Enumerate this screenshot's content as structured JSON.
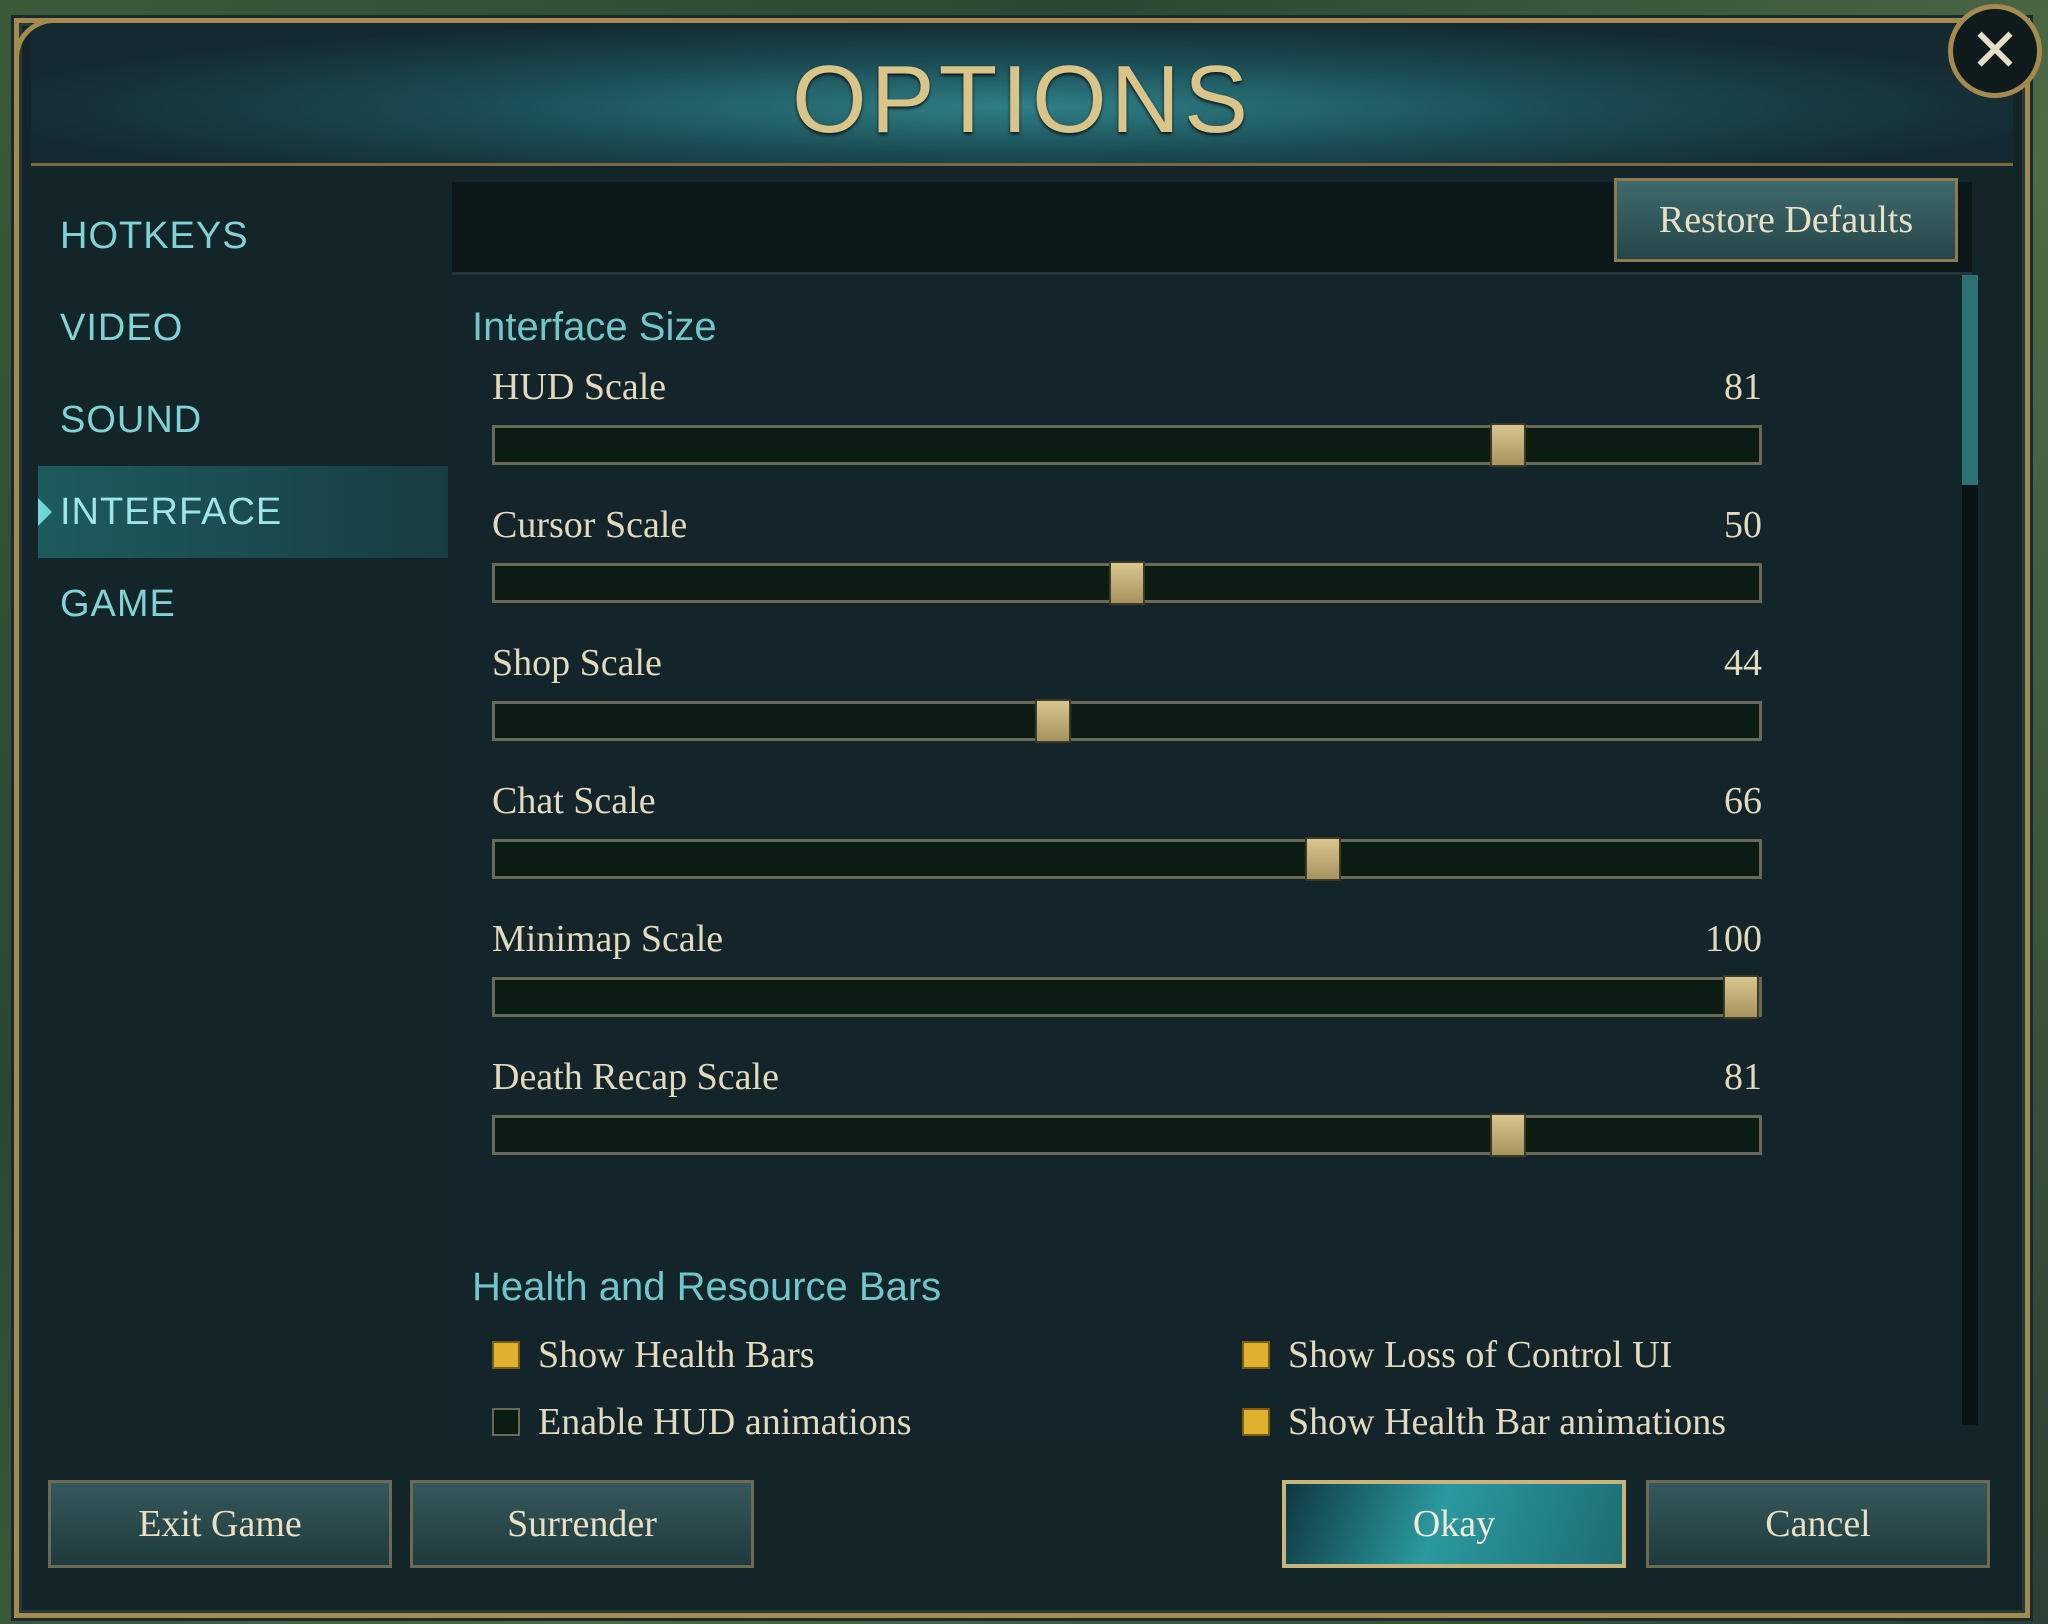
{
  "window": {
    "title": "OPTIONS"
  },
  "header": {
    "restore_defaults": "Restore Defaults"
  },
  "nav": {
    "items": [
      {
        "label": "HOTKEYS",
        "active": false
      },
      {
        "label": "VIDEO",
        "active": false
      },
      {
        "label": "SOUND",
        "active": false
      },
      {
        "label": "INTERFACE",
        "active": true
      },
      {
        "label": "GAME",
        "active": false
      }
    ]
  },
  "interface_size": {
    "title": "Interface Size",
    "sliders": [
      {
        "label": "HUD Scale",
        "value": 81
      },
      {
        "label": "Cursor Scale",
        "value": 50
      },
      {
        "label": "Shop Scale",
        "value": 44
      },
      {
        "label": "Chat Scale",
        "value": 66
      },
      {
        "label": "Minimap Scale",
        "value": 100
      },
      {
        "label": "Death Recap Scale",
        "value": 81
      }
    ]
  },
  "health_bars": {
    "title": "Health and Resource Bars",
    "options": [
      {
        "label": "Show Health Bars",
        "checked": true
      },
      {
        "label": "Show Loss of Control UI",
        "checked": true
      },
      {
        "label": "Enable HUD animations",
        "checked": false
      },
      {
        "label": "Show Health Bar animations",
        "checked": true
      }
    ]
  },
  "footer": {
    "exit_game": "Exit Game",
    "surrender": "Surrender",
    "okay": "Okay",
    "cancel": "Cancel"
  },
  "colors": {
    "gold": "#a48a4f",
    "accent_teal": "#6fc7ca",
    "slider_thumb": "#d9c58f",
    "checkbox_on": "#e0b030"
  },
  "icons": {
    "close": "close-x-icon",
    "active_nav": "triangle-right-icon"
  }
}
